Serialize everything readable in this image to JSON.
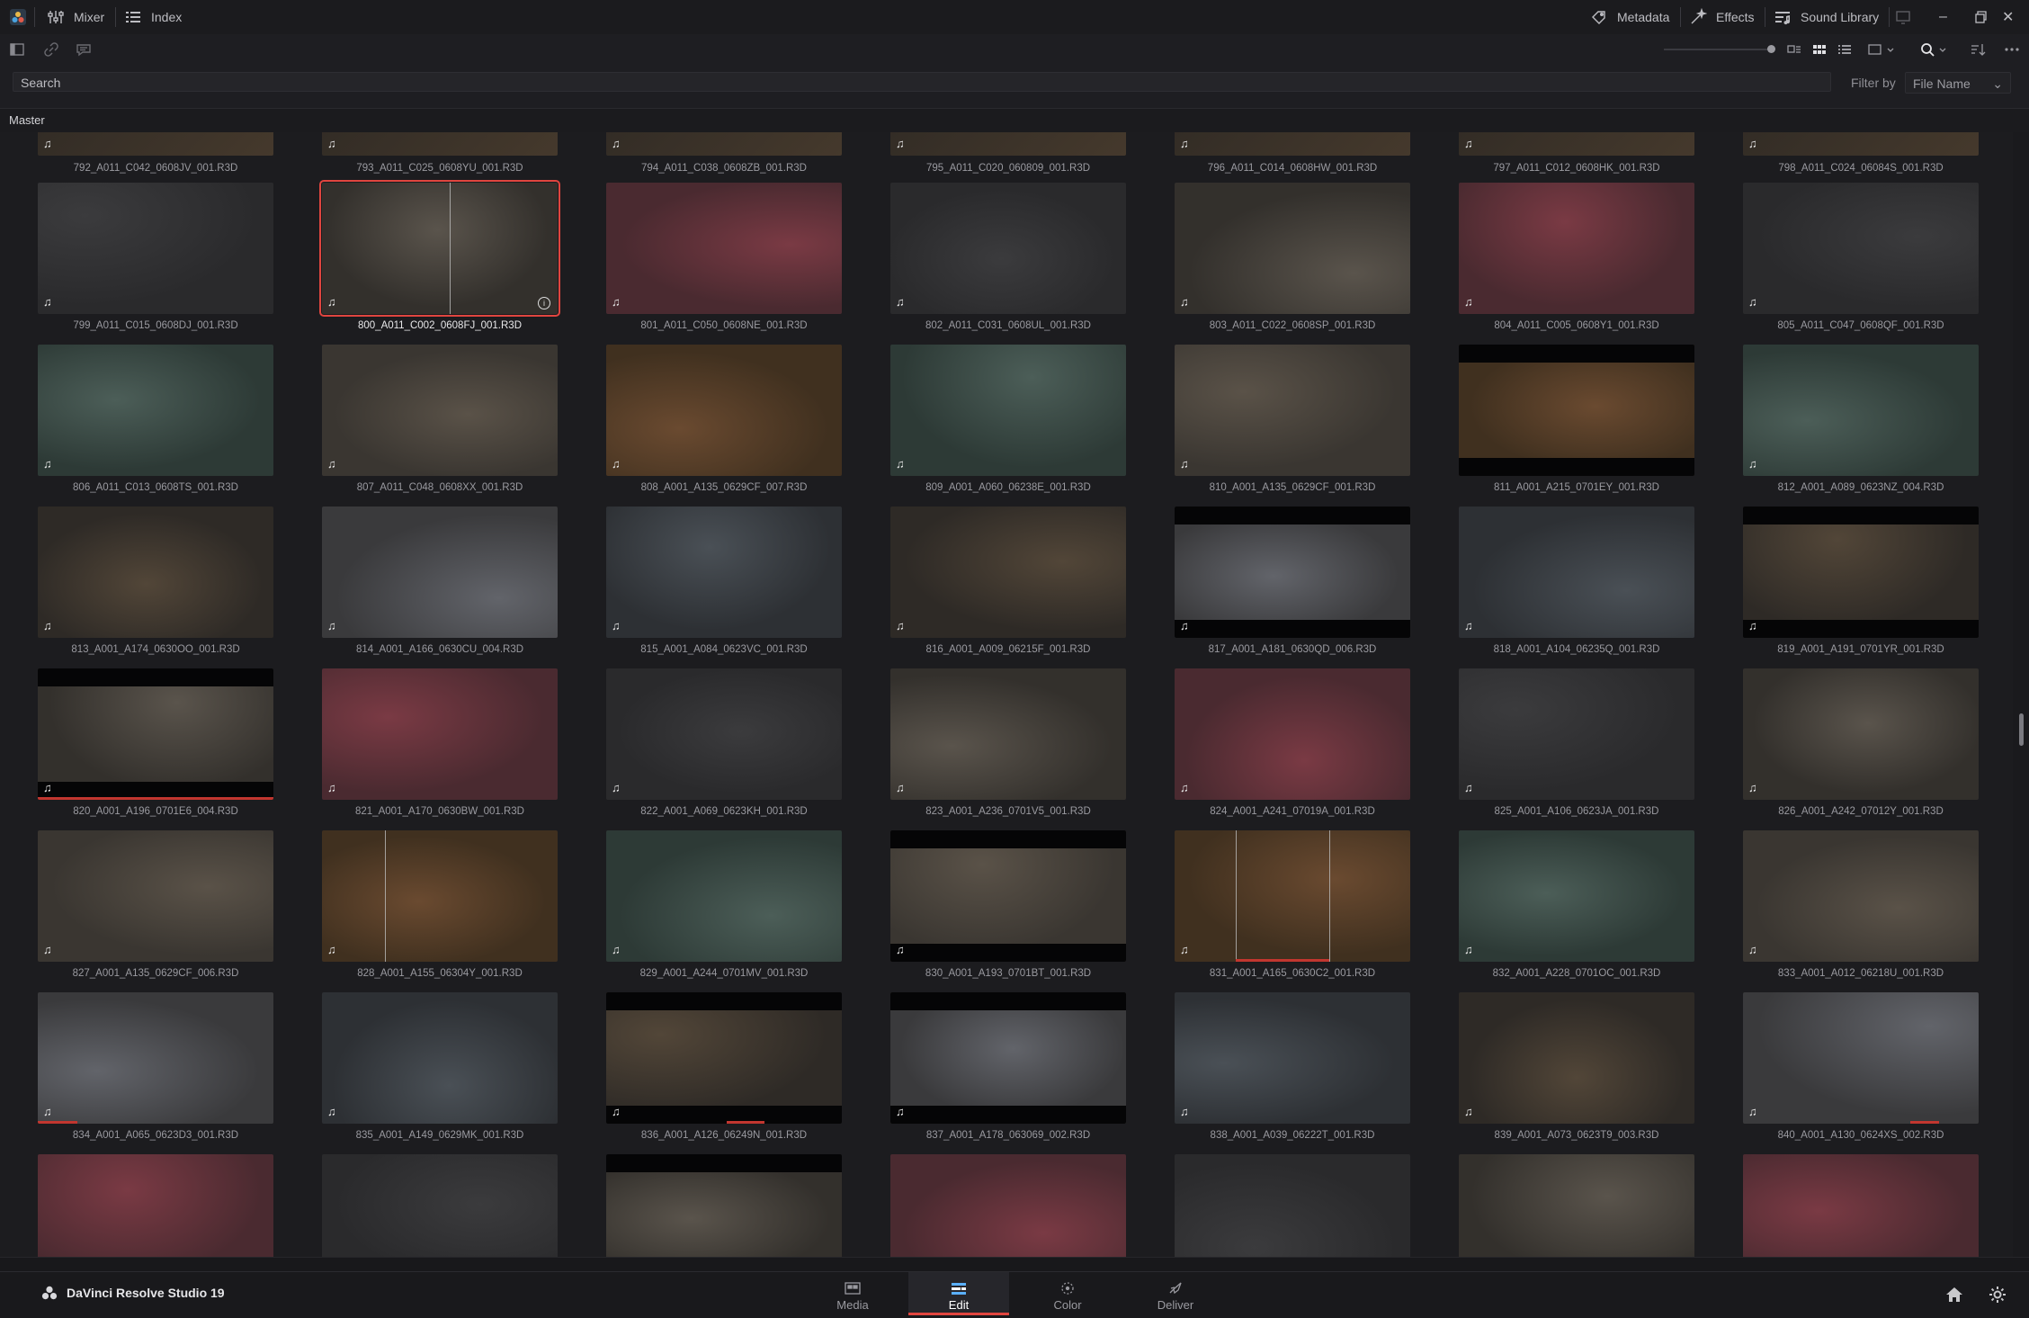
{
  "app": {
    "name": "DaVinci Resolve Studio 19"
  },
  "topbar": {
    "left": [
      {
        "id": "mixer",
        "label": "Mixer",
        "icon": "mixer-icon"
      },
      {
        "id": "index",
        "label": "Index",
        "icon": "index-list-icon"
      }
    ],
    "right": [
      {
        "id": "metadata",
        "label": "Metadata",
        "icon": "metadata-icon"
      },
      {
        "id": "effects",
        "label": "Effects",
        "icon": "effects-wand-icon"
      },
      {
        "id": "sound_library",
        "label": "Sound Library",
        "icon": "music-note-icon"
      }
    ],
    "window_controls": [
      "minimize",
      "maximize",
      "close"
    ]
  },
  "toolbar": {
    "left_icons": [
      "panel-toggle-icon",
      "link-icon",
      "speech-bubble-icon"
    ],
    "right_icons": [
      "zoom-slider",
      "strip-view-icon",
      "thumbnail-view-icon",
      "list-view-icon",
      "aspect-icon",
      "search-icon",
      "sort-icon",
      "more-icon"
    ]
  },
  "search": {
    "placeholder": "Search"
  },
  "filter": {
    "label": "Filter by",
    "value": "File Name"
  },
  "bin": {
    "name": "Master"
  },
  "clips": {
    "top_partial": [
      "792_A011_C042_0608JV_001.R3D",
      "793_A011_C025_0608YU_001.R3D",
      "794_A011_C038_0608ZB_001.R3D",
      "795_A011_C020_060809_001.R3D",
      "796_A011_C014_0608HW_001.R3D",
      "797_A011_C012_0608HK_001.R3D",
      "798_A011_C024_06084S_001.R3D"
    ],
    "rows": [
      [
        "799_A011_C015_0608DJ_001.R3D",
        "800_A011_C002_0608FJ_001.R3D",
        "801_A011_C050_0608NE_001.R3D",
        "802_A011_C031_0608UL_001.R3D",
        "803_A011_C022_0608SP_001.R3D",
        "804_A011_C005_0608Y1_001.R3D",
        "805_A011_C047_0608QF_001.R3D"
      ],
      [
        "806_A011_C013_0608TS_001.R3D",
        "807_A011_C048_0608XX_001.R3D",
        "808_A001_A135_0629CF_007.R3D",
        "809_A001_A060_06238E_001.R3D",
        "810_A001_A135_0629CF_001.R3D",
        "811_A001_A215_0701EY_001.R3D",
        "812_A001_A089_0623NZ_004.R3D"
      ],
      [
        "813_A001_A174_0630OO_001.R3D",
        "814_A001_A166_0630CU_004.R3D",
        "815_A001_A084_0623VC_001.R3D",
        "816_A001_A009_06215F_001.R3D",
        "817_A001_A181_0630QD_006.R3D",
        "818_A001_A104_06235Q_001.R3D",
        "819_A001_A191_0701YR_001.R3D"
      ],
      [
        "820_A001_A196_0701E6_004.R3D",
        "821_A001_A170_0630BW_001.R3D",
        "822_A001_A069_0623KH_001.R3D",
        "823_A001_A236_0701V5_001.R3D",
        "824_A001_A241_07019A_001.R3D",
        "825_A001_A106_0623JA_001.R3D",
        "826_A001_A242_07012Y_001.R3D"
      ],
      [
        "827_A001_A135_0629CF_006.R3D",
        "828_A001_A155_06304Y_001.R3D",
        "829_A001_A244_0701MV_001.R3D",
        "830_A001_A193_0701BT_001.R3D",
        "831_A001_A165_0630C2_001.R3D",
        "832_A001_A228_0701OC_001.R3D",
        "833_A001_A012_06218U_001.R3D"
      ],
      [
        "834_A001_A065_0623D3_001.R3D",
        "835_A001_A149_0629MK_001.R3D",
        "836_A001_A126_06249N_001.R3D",
        "837_A001_A178_063069_002.R3D",
        "838_A001_A039_06222T_001.R3D",
        "839_A001_A073_0623T9_003.R3D",
        "840_A001_A130_0624XS_002.R3D"
      ],
      [
        "",
        "",
        "",
        "",
        "",
        "",
        ""
      ]
    ],
    "selected": "800_A011_C002_0608FJ_001.R3D"
  },
  "pages": [
    {
      "id": "media",
      "label": "Media",
      "icon": "media-pool-icon"
    },
    {
      "id": "edit",
      "label": "Edit",
      "icon": "edit-timeline-icon",
      "active": true
    },
    {
      "id": "color",
      "label": "Color",
      "icon": "color-wheel-icon"
    },
    {
      "id": "deliver",
      "label": "Deliver",
      "icon": "deliver-rocket-icon"
    }
  ],
  "colors": {
    "accent": "#e0453f",
    "background": "#1e1e22"
  }
}
